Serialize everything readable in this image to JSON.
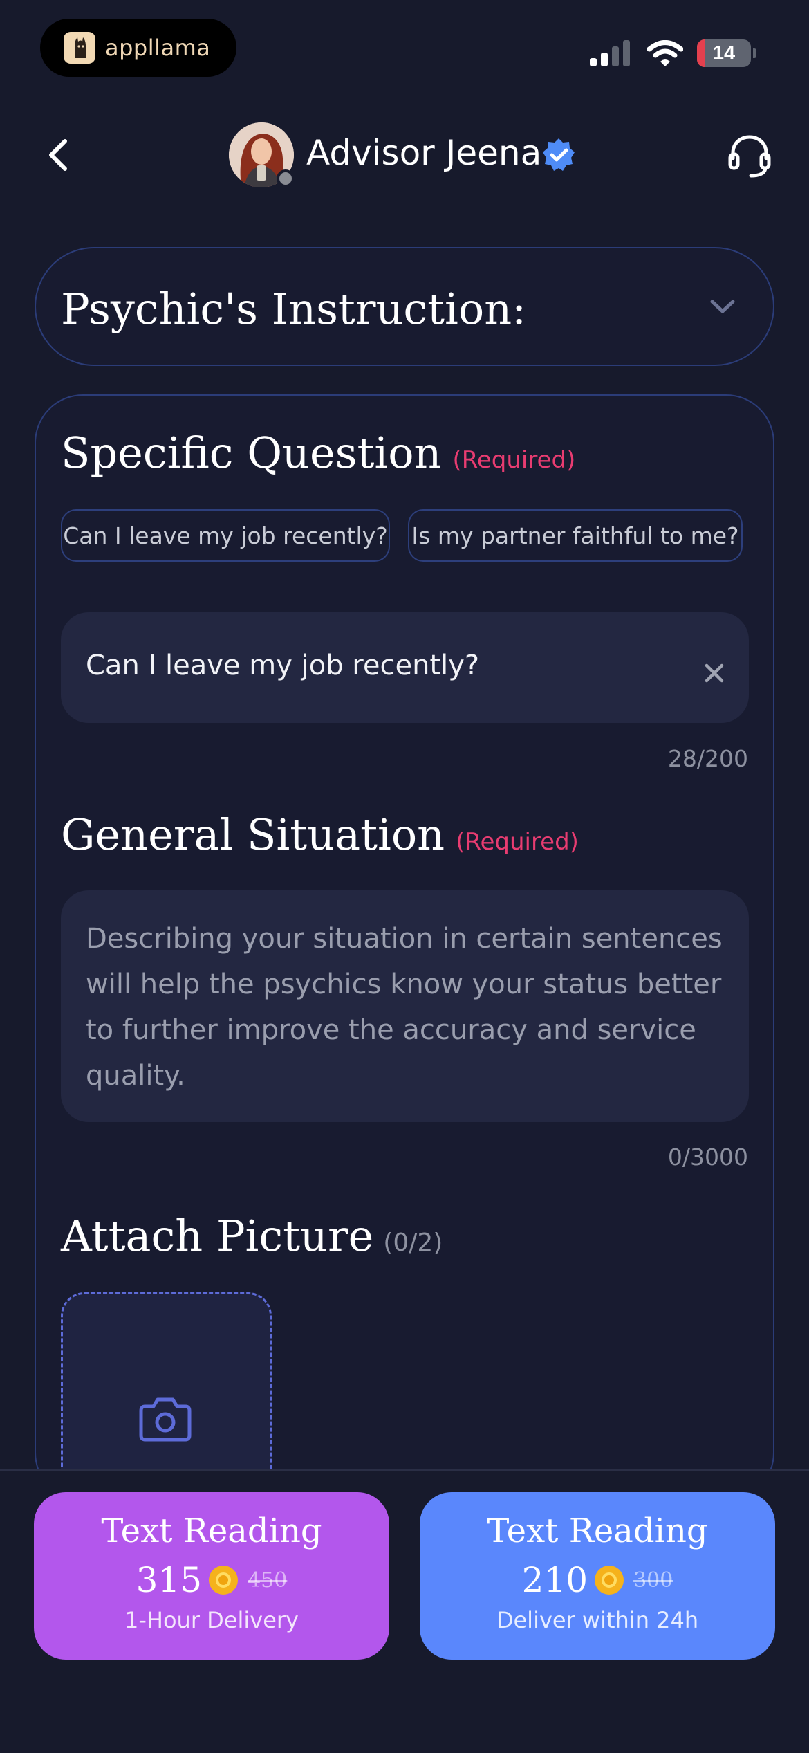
{
  "status_bar": {
    "app_badge_label": "appllama",
    "battery_level": "14",
    "battery_fraction": 0.14
  },
  "header": {
    "advisor_name": "Advisor Jeena"
  },
  "instruction": {
    "title": "Psychic's Instruction:"
  },
  "specific_question": {
    "title": "Specific Question",
    "required": "(Required)",
    "chips": [
      "Can I leave my job recently?",
      "Is my partner faithful to me?"
    ],
    "value": "Can I leave my job recently?",
    "counter": "28/200"
  },
  "general_situation": {
    "title": "General Situation",
    "required": "(Required)",
    "placeholder": "Describing your situation in certain sentences will help the psychics know your status better to further improve the accuracy and service quality.",
    "counter": "0/3000"
  },
  "attach": {
    "title": "Attach Picture",
    "count": "(0/2)"
  },
  "buttons": [
    {
      "title": "Text Reading",
      "price": "315",
      "old_price": "450",
      "subtitle": "1-Hour Delivery",
      "color": "#b357ec"
    },
    {
      "title": "Text Reading",
      "price": "210",
      "old_price": "300",
      "subtitle": "Deliver within 24h",
      "color": "#5a87fc"
    }
  ],
  "colors": {
    "background": "#171a2c",
    "card_border": "#2b3c78",
    "required": "#e83c71",
    "verified": "#4f8cf7",
    "upload_accent": "#5d6bd8"
  }
}
